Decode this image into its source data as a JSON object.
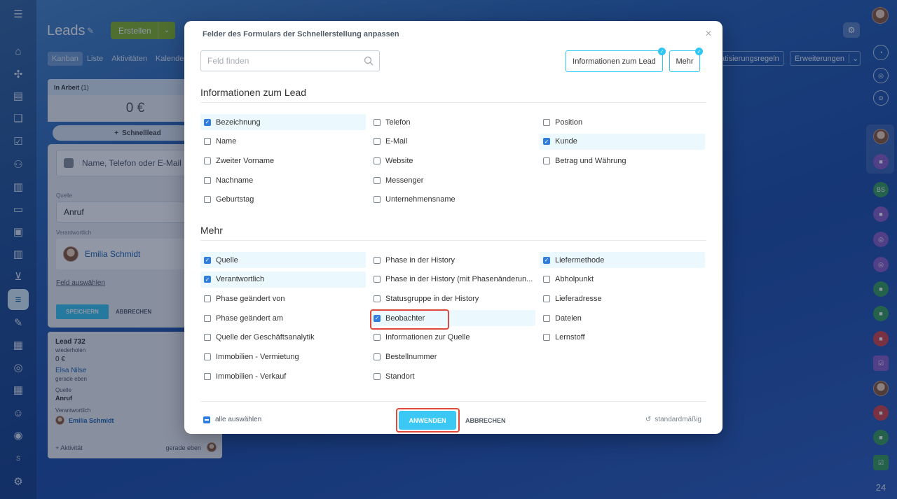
{
  "page": {
    "title": "Leads",
    "create_button": "Erstellen",
    "tabs": [
      "Kanban",
      "Liste",
      "Aktivitäten",
      "Kalende"
    ],
    "right_pills": {
      "automation": "atisierungsregeln",
      "extensions": "Erweiterungen"
    }
  },
  "kanban": {
    "column_header": "In Arbeit",
    "column_count": "(1)",
    "column_sum": "0 €",
    "quick_lead": "Schnelllead",
    "form": {
      "client_placeholder": "Name, Telefon oder E-Mail",
      "source_label": "Quelle",
      "source_value": "Anruf",
      "responsible_label": "Verantwortlich",
      "responsible_value": "Emilia Schmidt",
      "select_field": "Feld auswählen",
      "save": "SPEICHERN",
      "cancel": "ABBRECHEN"
    },
    "lead_card": {
      "title": "Lead 732",
      "subtitle": "wiederholen",
      "amount": "0 €",
      "contact": "Elsa Nilse",
      "contact_time": "gerade eben",
      "source_label": "Quelle",
      "source_value": "Anruf",
      "responsible_label": "Verantwortlich",
      "responsible_value": "Emilia Schmidt",
      "activity": "+ Aktivität",
      "activity_time": "gerade eben"
    }
  },
  "right_rail_labels": {
    "bs": "BS",
    "s": "S",
    "badge": "24"
  },
  "modal": {
    "title": "Felder des Formulars der Schnellerstellung anpassen",
    "search_placeholder": "Feld finden",
    "category_buttons": [
      "Informationen zum Lead",
      "Mehr"
    ],
    "sections": [
      {
        "title": "Informationen zum Lead",
        "columns": [
          [
            {
              "label": "Bezeichnung",
              "checked": true
            },
            {
              "label": "Name",
              "checked": false
            },
            {
              "label": "Zweiter Vorname",
              "checked": false
            },
            {
              "label": "Nachname",
              "checked": false
            },
            {
              "label": "Geburtstag",
              "checked": false
            }
          ],
          [
            {
              "label": "Telefon",
              "checked": false
            },
            {
              "label": "E-Mail",
              "checked": false
            },
            {
              "label": "Website",
              "checked": false
            },
            {
              "label": "Messenger",
              "checked": false
            },
            {
              "label": "Unternehmensname",
              "checked": false
            }
          ],
          [
            {
              "label": "Position",
              "checked": false
            },
            {
              "label": "Kunde",
              "checked": true
            },
            {
              "label": "Betrag und Währung",
              "checked": false
            }
          ]
        ]
      },
      {
        "title": "Mehr",
        "columns": [
          [
            {
              "label": "Quelle",
              "checked": true
            },
            {
              "label": "Verantwortlich",
              "checked": true
            },
            {
              "label": "Phase geändert von",
              "checked": false
            },
            {
              "label": "Phase geändert am",
              "checked": false
            },
            {
              "label": "Quelle der Geschäftsanalytik",
              "checked": false
            },
            {
              "label": "Immobilien - Vermietung",
              "checked": false
            },
            {
              "label": "Immobilien - Verkauf",
              "checked": false
            }
          ],
          [
            {
              "label": "Phase in der History",
              "checked": false
            },
            {
              "label": "Phase in der History (mit Phasenänderun...",
              "checked": false
            },
            {
              "label": "Statusgruppe in der History",
              "checked": false
            },
            {
              "label": "Beobachter",
              "checked": true,
              "highlighted": true
            },
            {
              "label": "Informationen zur Quelle",
              "checked": false
            },
            {
              "label": "Bestellnummer",
              "checked": false
            },
            {
              "label": "Standort",
              "checked": false
            }
          ],
          [
            {
              "label": "Liefermethode",
              "checked": true
            },
            {
              "label": "Abholpunkt",
              "checked": false
            },
            {
              "label": "Lieferadresse",
              "checked": false
            },
            {
              "label": "Dateien",
              "checked": false
            },
            {
              "label": "Lernstoff",
              "checked": false
            }
          ]
        ]
      }
    ],
    "select_all": "alle auswählen",
    "apply": "ANWENDEN",
    "cancel": "ABBRECHEN",
    "reset": "standardmäßig"
  },
  "colors": {
    "accent": "#2fc6f6",
    "checkbox": "#2f7ddc",
    "create_green": "#86b628",
    "highlight_red": "#e04a3a"
  }
}
